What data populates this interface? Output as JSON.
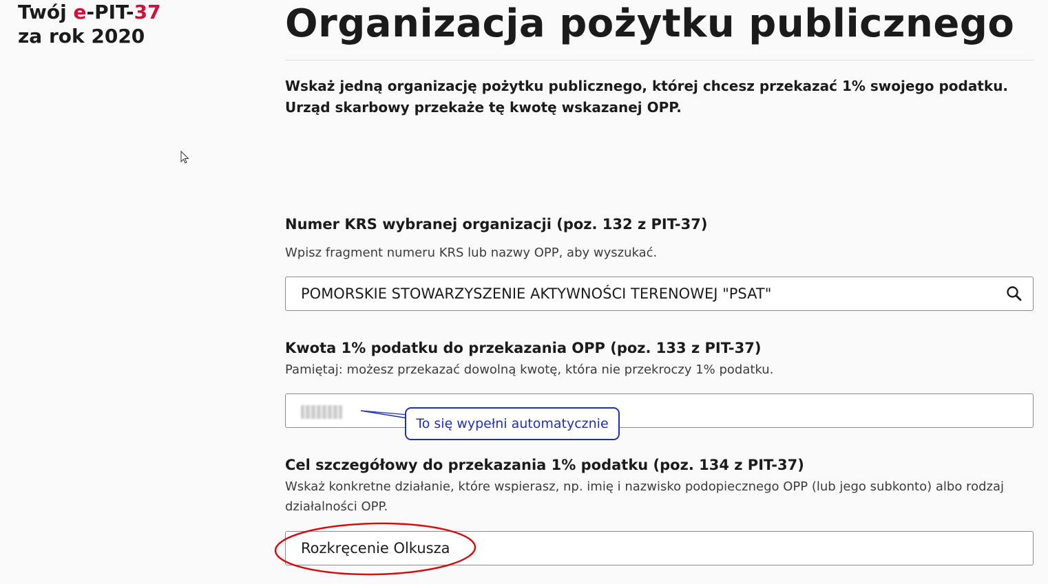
{
  "brand": {
    "prefix": "Twój ",
    "e": "e",
    "pit": "-PIT-",
    "num": "37",
    "year_line": "za rok 2020"
  },
  "page": {
    "title": "Organizacja pożytku publicznego",
    "intro": "Wskaż jedną organizację pożytku publicznego, której chcesz przekazać 1% swojego podatku. Urząd skarbowy przekaże tę kwotę wskazanej OPP."
  },
  "krs": {
    "label": "Numer KRS wybranej organizacji (poz. 132 z PIT-37)",
    "hint": "Wpisz fragment numeru KRS lub nazwy OPP, aby wyszukać.",
    "value": "POMORSKIE STOWARZYSZENIE AKTYWNOŚCI TERENOWEJ \"PSAT\"",
    "icon": "search-icon"
  },
  "amount": {
    "label": "Kwota 1% podatku do przekazania OPP (poz. 133 z PIT-37)",
    "hint": "Pamiętaj: możesz przekazać dowolną kwotę, która nie przekroczy 1% podatku."
  },
  "annotation": {
    "callout": "To się wypełni automatycznie",
    "callout_color": "#1e2fb4",
    "highlight_color": "#d01010"
  },
  "goal": {
    "label": "Cel szczegółowy do przekazania 1% podatku (poz. 134 z PIT-37)",
    "hint": "Wskaż konkretne działanie, które wspierasz, np. imię i nazwisko podopiecznego OPP (lub jego subkonto) albo rodzaj działalności OPP.",
    "value": "Rozkręcenie Olkusza"
  }
}
